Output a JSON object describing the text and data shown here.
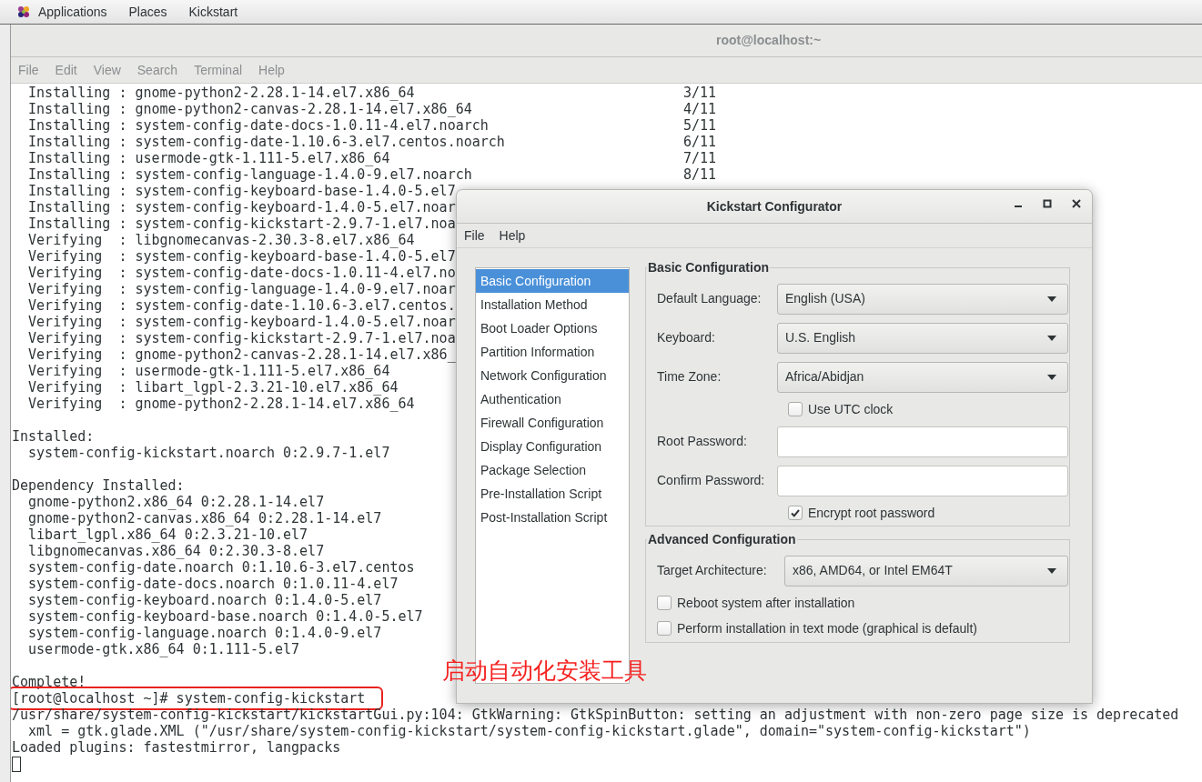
{
  "top_bar": {
    "menus": [
      "Applications",
      "Places",
      "Kickstart"
    ]
  },
  "terminal": {
    "title": "root@localhost:~",
    "menu": [
      "File",
      "Edit",
      "View",
      "Search",
      "Terminal",
      "Help"
    ],
    "lines": [
      {
        "kind": "text",
        "text": "  Installing : gnome-python2-2.28.1-14.el7.x86_64",
        "counter": "3/11",
        "boxed": false
      },
      {
        "kind": "text",
        "text": "  Installing : gnome-python2-canvas-2.28.1-14.el7.x86_64",
        "counter": "4/11",
        "boxed": false
      },
      {
        "kind": "text",
        "text": "  Installing : system-config-date-docs-1.0.11-4.el7.noarch",
        "counter": "5/11",
        "boxed": false
      },
      {
        "kind": "text",
        "text": "  Installing : system-config-date-1.10.6-3.el7.centos.noarch",
        "counter": "6/11",
        "boxed": false
      },
      {
        "kind": "text",
        "text": "  Installing : usermode-gtk-1.111-5.el7.x86_64",
        "counter": "7/11",
        "boxed": false
      },
      {
        "kind": "text",
        "text": "  Installing : system-config-language-1.4.0-9.el7.noarch",
        "counter": "8/11",
        "boxed": false
      },
      {
        "kind": "text",
        "text": "  Installing : system-config-keyboard-base-1.4.0-5.el7",
        "boxed": false
      },
      {
        "kind": "text",
        "text": "  Installing : system-config-keyboard-1.4.0-5.el7.noar",
        "boxed": false
      },
      {
        "kind": "text",
        "text": "  Installing : system-config-kickstart-2.9.7-1.el7.noa",
        "boxed": false
      },
      {
        "kind": "text",
        "text": "  Verifying  : libgnomecanvas-2.30.3-8.el7.x86_64",
        "boxed": false
      },
      {
        "kind": "text",
        "text": "  Verifying  : system-config-keyboard-base-1.4.0-5.el7",
        "boxed": false
      },
      {
        "kind": "text",
        "text": "  Verifying  : system-config-date-docs-1.0.11-4.el7.no",
        "boxed": false
      },
      {
        "kind": "text",
        "text": "  Verifying  : system-config-language-1.4.0-9.el7.noar",
        "boxed": false
      },
      {
        "kind": "text",
        "text": "  Verifying  : system-config-date-1.10.6-3.el7.centos.",
        "boxed": false
      },
      {
        "kind": "text",
        "text": "  Verifying  : system-config-keyboard-1.4.0-5.el7.noar",
        "boxed": false
      },
      {
        "kind": "text",
        "text": "  Verifying  : system-config-kickstart-2.9.7-1.el7.noa",
        "boxed": false
      },
      {
        "kind": "text",
        "text": "  Verifying  : gnome-python2-canvas-2.28.1-14.el7.x86_",
        "boxed": false
      },
      {
        "kind": "text",
        "text": "  Verifying  : usermode-gtk-1.111-5.el7.x86_64",
        "boxed": false
      },
      {
        "kind": "text",
        "text": "  Verifying  : libart_lgpl-2.3.21-10.el7.x86_64",
        "boxed": false
      },
      {
        "kind": "text",
        "text": "  Verifying  : gnome-python2-2.28.1-14.el7.x86_64",
        "boxed": false
      },
      {
        "kind": "blank"
      },
      {
        "kind": "text",
        "text": "Installed:",
        "boxed": false
      },
      {
        "kind": "text",
        "text": "  system-config-kickstart.noarch 0:2.9.7-1.el7",
        "boxed": false
      },
      {
        "kind": "blank"
      },
      {
        "kind": "text",
        "text": "Dependency Installed:",
        "boxed": false
      },
      {
        "kind": "text",
        "text": "  gnome-python2.x86_64 0:2.28.1-14.el7",
        "boxed": false
      },
      {
        "kind": "text",
        "text": "  gnome-python2-canvas.x86_64 0:2.28.1-14.el7",
        "boxed": false
      },
      {
        "kind": "text",
        "text": "  libart_lgpl.x86_64 0:2.3.21-10.el7",
        "boxed": false
      },
      {
        "kind": "text",
        "text": "  libgnomecanvas.x86_64 0:2.30.3-8.el7",
        "boxed": false
      },
      {
        "kind": "text",
        "text": "  system-config-date.noarch 0:1.10.6-3.el7.centos",
        "boxed": false
      },
      {
        "kind": "text",
        "text": "  system-config-date-docs.noarch 0:1.0.11-4.el7",
        "boxed": false
      },
      {
        "kind": "text",
        "text": "  system-config-keyboard.noarch 0:1.4.0-5.el7",
        "boxed": false
      },
      {
        "kind": "text",
        "text": "  system-config-keyboard-base.noarch 0:1.4.0-5.el7",
        "boxed": false
      },
      {
        "kind": "text",
        "text": "  system-config-language.noarch 0:1.4.0-9.el7",
        "boxed": false
      },
      {
        "kind": "text",
        "text": "  usermode-gtk.x86_64 0:1.111-5.el7",
        "boxed": false
      },
      {
        "kind": "blank"
      },
      {
        "kind": "text",
        "text": "Complete!",
        "boxed": false
      },
      {
        "kind": "text",
        "text": "[root@localhost ~]# system-config-kickstart",
        "boxed": true
      },
      {
        "kind": "text",
        "text": "/usr/share/system-config-kickstart/kickstartGui.py:104: GtkWarning: GtkSpinButton: setting an adjustment with non-zero page size is deprecated",
        "boxed": false
      },
      {
        "kind": "text",
        "text": "  xml = gtk.glade.XML (\"/usr/share/system-config-kickstart/system-config-kickstart.glade\", domain=\"system-config-kickstart\")",
        "boxed": false
      },
      {
        "kind": "text",
        "text": "Loaded plugins: fastestmirror, langpacks",
        "boxed": false
      },
      {
        "kind": "cursor"
      }
    ]
  },
  "annotation": {
    "text": "启动自动化安装工具"
  },
  "dialog": {
    "title": "Kickstart Configurator",
    "menu": [
      "File",
      "Help"
    ],
    "sidebar": [
      {
        "label": "Basic Configuration",
        "selected": true
      },
      {
        "label": "Installation Method",
        "selected": false
      },
      {
        "label": "Boot Loader Options",
        "selected": false
      },
      {
        "label": "Partition Information",
        "selected": false
      },
      {
        "label": "Network Configuration",
        "selected": false
      },
      {
        "label": "Authentication",
        "selected": false
      },
      {
        "label": "Firewall Configuration",
        "selected": false
      },
      {
        "label": "Display Configuration",
        "selected": false
      },
      {
        "label": "Package Selection",
        "selected": false
      },
      {
        "label": "Pre-Installation Script",
        "selected": false
      },
      {
        "label": "Post-Installation Script",
        "selected": false
      }
    ],
    "sections": [
      {
        "title": "Basic Configuration",
        "fields": [
          {
            "kind": "dropdown",
            "label": "Default Language:",
            "value": "English (USA)"
          },
          {
            "kind": "dropdown",
            "label": "Keyboard:",
            "value": "U.S. English"
          },
          {
            "kind": "dropdown",
            "label": "Time Zone:",
            "value": "Africa/Abidjan"
          },
          {
            "kind": "field_checkbox",
            "label": "Use UTC clock",
            "checked": false
          },
          {
            "kind": "password",
            "label": "Root Password:"
          },
          {
            "kind": "password",
            "label": "Confirm Password:"
          },
          {
            "kind": "field_checkbox",
            "label": "Encrypt root password",
            "checked": true
          }
        ]
      },
      {
        "title": "Advanced Configuration",
        "fields": [
          {
            "kind": "dropdown",
            "label": "Target Architecture:",
            "value": "x86, AMD64, or Intel EM64T"
          },
          {
            "kind": "checkbox",
            "label": "Reboot system after installation",
            "checked": false
          },
          {
            "kind": "checkbox",
            "label": "Perform installation in text mode (graphical is default)",
            "checked": false
          }
        ]
      }
    ]
  }
}
